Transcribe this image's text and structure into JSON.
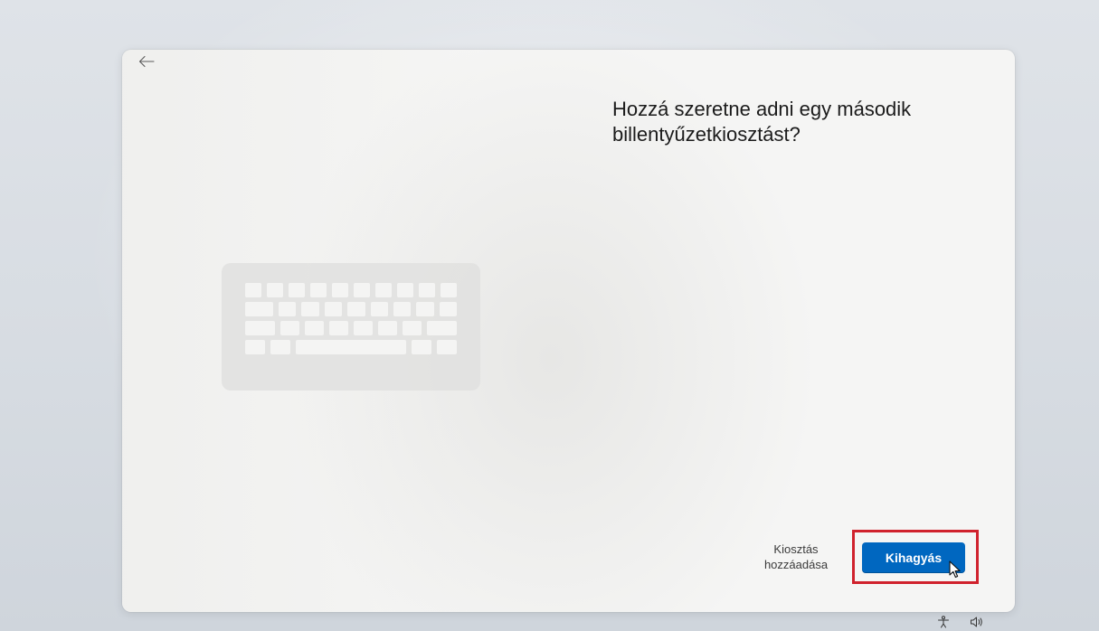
{
  "header": {
    "back_icon": "arrow-left-icon"
  },
  "main": {
    "title": "Hozzá szeretne adni egy második billentyűzetkiosztást?",
    "illustration_icon": "keyboard-icon"
  },
  "footer": {
    "secondary_label": "Kiosztás hozzáadása",
    "primary_label": "Kihagyás",
    "highlight_color": "#d0222d"
  },
  "tray": {
    "icons": [
      "accessibility-icon",
      "volume-icon"
    ]
  },
  "colors": {
    "accent": "#0067c0",
    "card_bg": "#f5f5f4",
    "text": "#1b1b1b"
  }
}
